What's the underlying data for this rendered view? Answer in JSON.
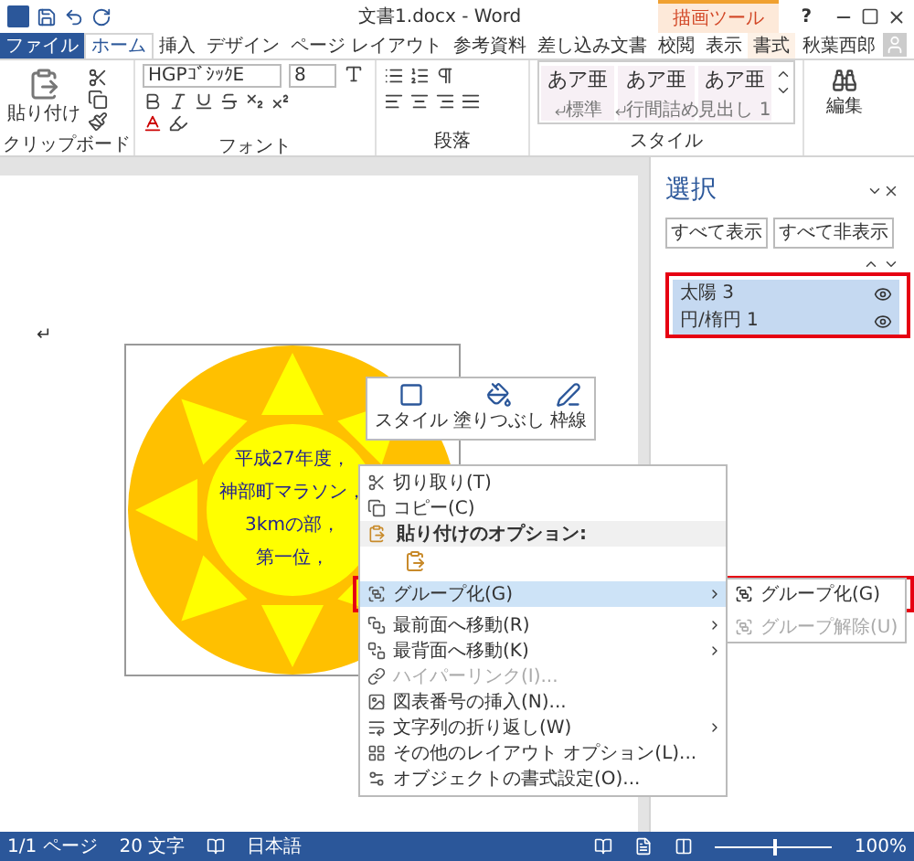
{
  "title_bar": {
    "title": "文書1.docx - Word",
    "contextual_group": "描画ツール",
    "help": "?"
  },
  "tabs": [
    {
      "label": "ファイル",
      "kind": "file",
      "selected": false
    },
    {
      "label": "ホーム",
      "kind": "normal",
      "selected": true
    },
    {
      "label": "挿入",
      "kind": "normal",
      "selected": false
    },
    {
      "label": "デザイン",
      "kind": "normal",
      "selected": false
    },
    {
      "label": "ページ レイアウト",
      "kind": "normal",
      "selected": false
    },
    {
      "label": "参考資料",
      "kind": "normal",
      "selected": false
    },
    {
      "label": "差し込み文書",
      "kind": "normal",
      "selected": false
    },
    {
      "label": "校閲",
      "kind": "normal",
      "selected": false
    },
    {
      "label": "表示",
      "kind": "normal",
      "selected": false
    },
    {
      "label": "書式",
      "kind": "contextual",
      "selected": false
    }
  ],
  "user": "秋葉西郎",
  "ribbon": {
    "clipboard": {
      "label": "クリップボード",
      "paste": "貼り付け"
    },
    "font": {
      "label": "フォント",
      "font_name": "HGPｺﾞｼｯｸE",
      "font_size": "8"
    },
    "paragraph": {
      "label": "段落"
    },
    "styles": {
      "label": "スタイル",
      "items": [
        {
          "preview": "あア亜",
          "name": "標準",
          "mark": true
        },
        {
          "preview": "あア亜",
          "name": "行間詰め",
          "mark": true
        },
        {
          "preview": "あア亜",
          "name": "見出し 1",
          "mark": false
        }
      ]
    },
    "editing": {
      "label": "編集"
    }
  },
  "document": {
    "paragraph_mark": "↵",
    "sun_text": [
      "平成27年度，",
      "神部町マラソン，",
      "3kmの部，",
      "第一位，"
    ]
  },
  "mini_toolbar": [
    {
      "label": "スタイル",
      "kind": "style"
    },
    {
      "label": "塗りつぶし",
      "kind": "fill"
    },
    {
      "label": "枠線",
      "kind": "outline"
    }
  ],
  "context_menu": [
    {
      "kind": "item",
      "label": "切り取り(T)",
      "disabled": false,
      "submenu": false,
      "selected": false
    },
    {
      "kind": "item",
      "label": "コピー(C)",
      "disabled": false,
      "submenu": false,
      "selected": false
    },
    {
      "kind": "header",
      "label": "貼り付けのオプション:"
    },
    {
      "kind": "paste"
    },
    {
      "kind": "item",
      "label": "グループ化(G)",
      "disabled": false,
      "submenu": true,
      "selected": true
    },
    {
      "kind": "item",
      "label": "最前面へ移動(R)",
      "disabled": false,
      "submenu": true,
      "selected": false
    },
    {
      "kind": "item",
      "label": "最背面へ移動(K)",
      "disabled": false,
      "submenu": true,
      "selected": false
    },
    {
      "kind": "item",
      "label": "ハイパーリンク(I)...",
      "disabled": true,
      "submenu": false,
      "selected": false
    },
    {
      "kind": "item",
      "label": "図表番号の挿入(N)...",
      "disabled": false,
      "submenu": false,
      "selected": false
    },
    {
      "kind": "item",
      "label": "文字列の折り返し(W)",
      "disabled": false,
      "submenu": true,
      "selected": false
    },
    {
      "kind": "item",
      "label": "その他のレイアウト オプション(L)...",
      "disabled": false,
      "submenu": false,
      "selected": false
    },
    {
      "kind": "item",
      "label": "オブジェクトの書式設定(O)...",
      "disabled": false,
      "submenu": false,
      "selected": false
    }
  ],
  "submenu": [
    {
      "label": "グループ化(G)",
      "disabled": false
    },
    {
      "label": "グループ解除(U)",
      "disabled": true
    }
  ],
  "selection_pane": {
    "title": "選択",
    "buttons": [
      "すべて表示",
      "すべて非表示"
    ],
    "items": [
      {
        "label": "太陽 3",
        "selected": true
      },
      {
        "label": "円/楕円 1",
        "selected": true
      }
    ]
  },
  "status_bar": {
    "page": "1/1 ページ",
    "words": "20 文字",
    "language": "日本語",
    "zoom": "100%",
    "zoom_slider": {
      "level": 0.5
    }
  }
}
